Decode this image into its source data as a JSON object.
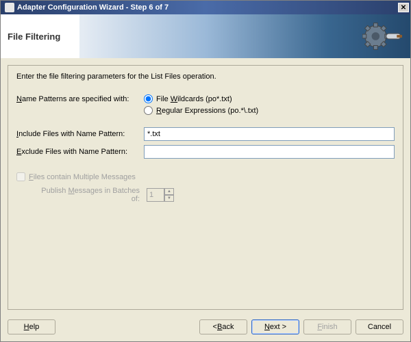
{
  "window": {
    "title": "Adapter Configuration Wizard - Step 6 of 7"
  },
  "header": {
    "page_title": "File Filtering"
  },
  "panel": {
    "instruction": "Enter the file filtering parameters for the List Files operation.",
    "name_patterns_label": "Name Patterns are specified with:",
    "radio_wildcards": "File Wildcards (po*.txt)",
    "radio_regex": "Regular Expressions (po.*\\.txt)",
    "radio_selected": "wildcards",
    "include_label": "Include Files with Name Pattern:",
    "include_value": "*.txt",
    "exclude_label": "Exclude Files with Name Pattern:",
    "exclude_value": "",
    "multi_msg_label": "Files contain Multiple Messages",
    "multi_msg_checked": false,
    "batch_label": "Publish Messages in Batches of:",
    "batch_value": "1"
  },
  "buttons": {
    "help": "Help",
    "back": "< Back",
    "next": "Next >",
    "finish": "Finish",
    "cancel": "Cancel"
  }
}
